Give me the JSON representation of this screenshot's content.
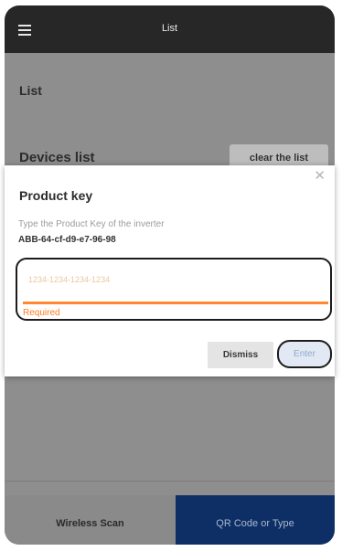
{
  "appbar": {
    "title": "List",
    "menu_icon": "menu-icon"
  },
  "page": {
    "heading": "List",
    "devices_title": "Devices list",
    "clear_button": "clear the list"
  },
  "dialog": {
    "close_icon": "close-icon",
    "title": "Product key",
    "description": "Type the Product Key of the inverter",
    "serial": "ABB-64-cf-d9-e7-96-98",
    "input_value": "",
    "input_placeholder": "1234-1234-1234-1234",
    "error_text": "Required",
    "dismiss_label": "Dismiss",
    "enter_label": "Enter"
  },
  "bottom_nav": {
    "wireless_label": "Wireless Scan",
    "qr_label": "QR Code or Type"
  },
  "colors": {
    "appbar": "#272727",
    "overlay": "#8e8e8e",
    "accent_orange": "#ff8730",
    "nav_active": "#0e2f66"
  }
}
